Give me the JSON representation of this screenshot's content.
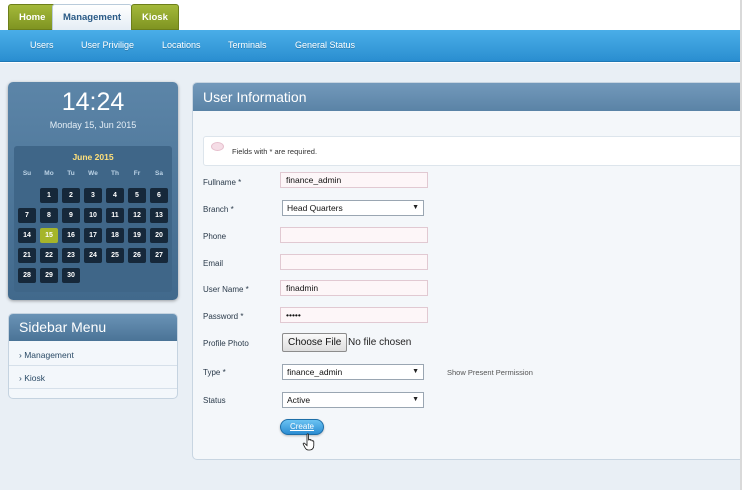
{
  "top_tabs": [
    {
      "label": "Home",
      "active": false
    },
    {
      "label": "Management",
      "active": true
    },
    {
      "label": "Kiosk",
      "active": false
    }
  ],
  "subnav": [
    "Users",
    "User Privilige",
    "Locations",
    "Terminals",
    "General Status"
  ],
  "clock": {
    "time": "14:24",
    "date": "Monday 15, Jun 2015",
    "calendar": {
      "month": "June 2015",
      "weekdays": [
        "Su",
        "Mo",
        "Tu",
        "We",
        "Th",
        "Fr",
        "Sa"
      ],
      "weeks": [
        [
          "",
          "1",
          "2",
          "3",
          "4",
          "5",
          "6"
        ],
        [
          "7",
          "8",
          "9",
          "10",
          "11",
          "12",
          "13"
        ],
        [
          "14",
          "15",
          "16",
          "17",
          "18",
          "19",
          "20"
        ],
        [
          "21",
          "22",
          "23",
          "24",
          "25",
          "26",
          "27"
        ],
        [
          "28",
          "29",
          "30",
          "",
          "",
          "",
          ""
        ]
      ],
      "today": "15"
    }
  },
  "sidebar": {
    "title": "Sidebar Menu",
    "items": [
      "Management",
      "Kiosk"
    ]
  },
  "form": {
    "title": "User Information",
    "notice": "Fields with * are required.",
    "fullname_label": "Fullname *",
    "fullname_value": "finance_admin",
    "branch_label": "Branch *",
    "branch_value": "Head Quarters",
    "phone_label": "Phone",
    "phone_value": "",
    "email_label": "Email",
    "email_value": "",
    "username_label": "User Name *",
    "username_value": "finadmin",
    "password_label": "Password *",
    "password_value": "•••••",
    "photo_label": "Profile Photo",
    "photo_button": "Choose File",
    "photo_status": "No file chosen",
    "type_label": "Type *",
    "type_value": "finance_admin",
    "permission_link": "Show Present Permission",
    "status_label": "Status",
    "status_value": "Active",
    "create_button": "Create"
  },
  "colors": {
    "tab_green": "#8fa52c",
    "subnav_blue": "#3a9edc",
    "panel_header": "#5a83a6",
    "today_highlight": "#a5b52a"
  }
}
